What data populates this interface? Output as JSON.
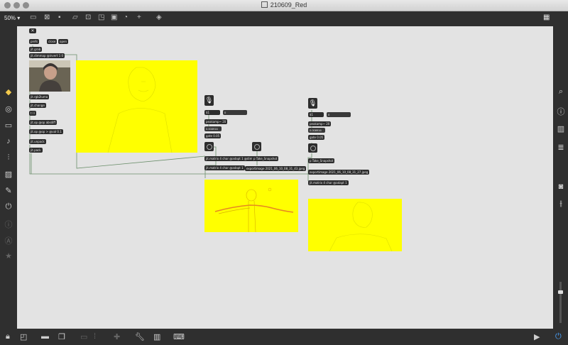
{
  "window": {
    "title": "210609_Red"
  },
  "toolbar": {
    "zoom": "50%"
  },
  "patch": {
    "top_objects": [
      {
        "id": "close-x",
        "label": "✕"
      },
      {
        "id": "prefs",
        "label": "prefs"
      },
      {
        "id": "close",
        "label": "close"
      },
      {
        "id": "open",
        "label": "open"
      },
      {
        "id": "grab",
        "label": "jit.grab"
      },
      {
        "id": "dimmap",
        "label": "jit.dimmap @invert 1 0"
      }
    ],
    "left_chain": [
      "jit.rgb2luma",
      "jit.change",
      "t l l",
      "jit.op @op absdiff",
      "jit.op @op > @val 0.1",
      "jit.unpack",
      "jit.pack"
    ],
    "mid_chain": {
      "sub1": "$1",
      "num1": "0",
      "peakamp": "peakamp~ 20",
      "val1": "0.008916",
      "gate": "gate 0.05",
      "matrix_in": "jit.matrix 4 char @adapt 1 @dim 1 2",
      "matrix_out": "jit.matrix 4 char @adapt 1",
      "snapshot": "p Take_Snapshot",
      "export": "exportimage 2021_06_10_08_31_43.jpeg"
    },
    "right_chain": {
      "sub1": "$1",
      "num1": "0",
      "peakamp": "peakamp~ 20",
      "val1": "0.008916",
      "gate": "gate 0.05",
      "snapshot": "p Take_Snapshot",
      "export": "exportimage 2021_06_10_08_31_27.jpeg",
      "matrix_out": "jit.matrix 4 char @adapt 1"
    }
  },
  "colors": {
    "preview": "#ffff00",
    "canvas": "#e3e3e3",
    "object": "#2d2d2d"
  }
}
